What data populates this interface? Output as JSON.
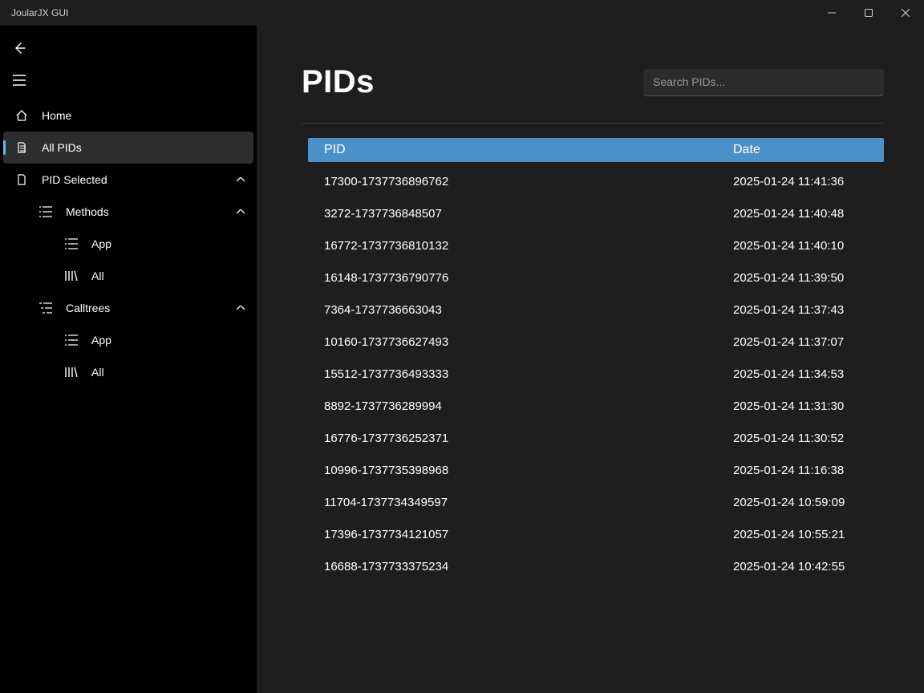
{
  "window": {
    "title": "JoularJX GUI"
  },
  "sidebar": {
    "home_label": "Home",
    "all_pids_label": "All PIDs",
    "pid_selected_label": "PID Selected",
    "methods_label": "Methods",
    "methods_app_label": "App",
    "methods_all_label": "All",
    "calltrees_label": "Calltrees",
    "calltrees_app_label": "App",
    "calltrees_all_label": "All"
  },
  "main": {
    "title": "PIDs",
    "search_placeholder": "Search PIDs...",
    "columns": {
      "pid": "PID",
      "date": "Date"
    },
    "rows": [
      {
        "pid": "17300-1737736896762",
        "date": "2025-01-24 11:41:36"
      },
      {
        "pid": "3272-1737736848507",
        "date": "2025-01-24 11:40:48"
      },
      {
        "pid": "16772-1737736810132",
        "date": "2025-01-24 11:40:10"
      },
      {
        "pid": "16148-1737736790776",
        "date": "2025-01-24 11:39:50"
      },
      {
        "pid": "7364-1737736663043",
        "date": "2025-01-24 11:37:43"
      },
      {
        "pid": "10160-1737736627493",
        "date": "2025-01-24 11:37:07"
      },
      {
        "pid": "15512-1737736493333",
        "date": "2025-01-24 11:34:53"
      },
      {
        "pid": "8892-1737736289994",
        "date": "2025-01-24 11:31:30"
      },
      {
        "pid": "16776-1737736252371",
        "date": "2025-01-24 11:30:52"
      },
      {
        "pid": "10996-1737735398968",
        "date": "2025-01-24 11:16:38"
      },
      {
        "pid": "11704-1737734349597",
        "date": "2025-01-24 10:59:09"
      },
      {
        "pid": "17396-1737734121057",
        "date": "2025-01-24 10:55:21"
      },
      {
        "pid": "16688-1737733375234",
        "date": "2025-01-24 10:42:55"
      }
    ]
  }
}
